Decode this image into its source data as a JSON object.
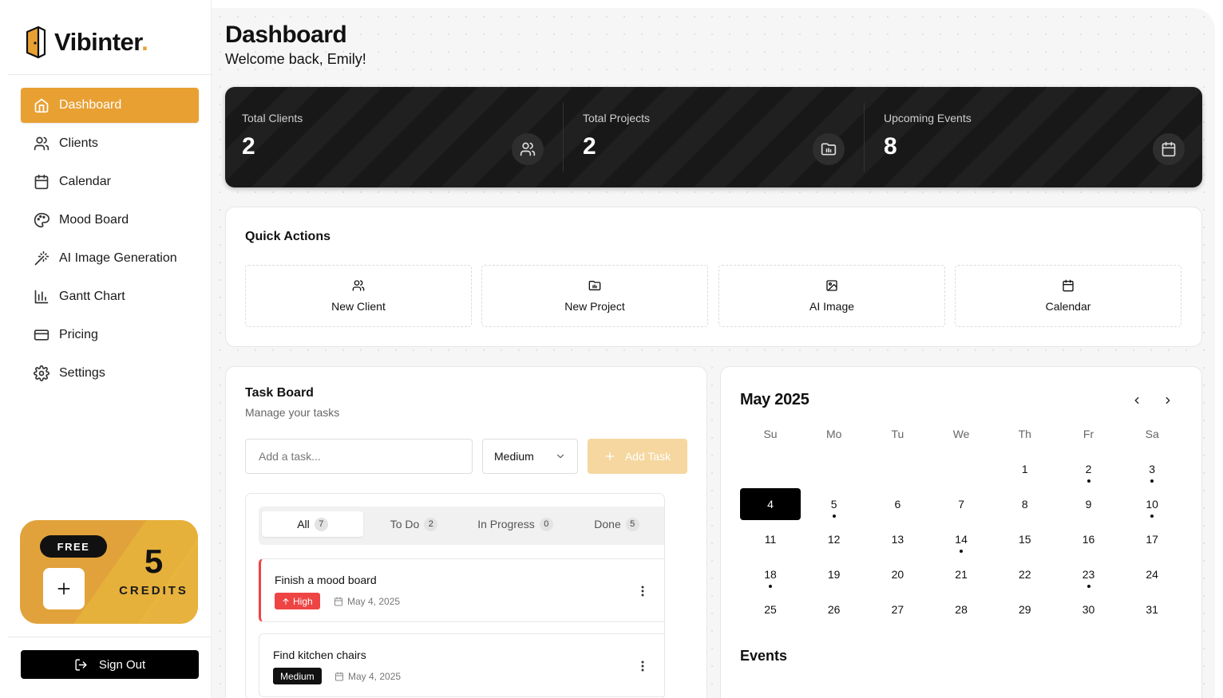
{
  "brand": {
    "name": "Vibinter",
    "dot": ".",
    "accent": "#e8a033"
  },
  "sidebar": {
    "items": [
      {
        "label": "Dashboard",
        "icon": "home-icon",
        "active": true
      },
      {
        "label": "Clients",
        "icon": "users-icon"
      },
      {
        "label": "Calendar",
        "icon": "calendar-icon"
      },
      {
        "label": "Mood Board",
        "icon": "palette-icon"
      },
      {
        "label": "AI Image Generation",
        "icon": "wand-icon"
      },
      {
        "label": "Gantt Chart",
        "icon": "bar-chart-icon"
      },
      {
        "label": "Pricing",
        "icon": "credit-card-icon"
      },
      {
        "label": "Settings",
        "icon": "gear-icon"
      }
    ],
    "plan": {
      "badge": "FREE",
      "credits": "5",
      "credits_label": "CREDITS"
    },
    "sign_out": "Sign Out"
  },
  "header": {
    "title": "Dashboard",
    "subtitle": "Welcome back, Emily!"
  },
  "stats": [
    {
      "label": "Total Clients",
      "value": "2",
      "icon": "users-icon"
    },
    {
      "label": "Total Projects",
      "value": "2",
      "icon": "folder-icon"
    },
    {
      "label": "Upcoming Events",
      "value": "8",
      "icon": "calendar-icon"
    }
  ],
  "quick_actions": {
    "title": "Quick Actions",
    "items": [
      {
        "label": "New Client",
        "icon": "users-icon"
      },
      {
        "label": "New Project",
        "icon": "folder-icon"
      },
      {
        "label": "AI Image",
        "icon": "image-icon"
      },
      {
        "label": "Calendar",
        "icon": "calendar-icon"
      }
    ]
  },
  "task_board": {
    "title": "Task Board",
    "subtitle": "Manage your tasks",
    "input_placeholder": "Add a task...",
    "priority_value": "Medium",
    "add_label": "Add Task",
    "tabs": [
      {
        "label": "All",
        "count": "7",
        "active": true
      },
      {
        "label": "To Do",
        "count": "2"
      },
      {
        "label": "In Progress",
        "count": "0"
      },
      {
        "label": "Done",
        "count": "5"
      }
    ],
    "tasks": [
      {
        "name": "Finish a mood board",
        "priority": "High",
        "date": "May 4, 2025"
      },
      {
        "name": "Find kitchen chairs",
        "priority": "Medium",
        "date": "May 4, 2025"
      }
    ]
  },
  "calendar": {
    "month_label": "May 2025",
    "weekdays": [
      "Su",
      "Mo",
      "Tu",
      "We",
      "Th",
      "Fr",
      "Sa"
    ],
    "first_weekday": 4,
    "days_in_month": 31,
    "selected_day": 4,
    "event_days": [
      2,
      3,
      5,
      10,
      14,
      18,
      23
    ],
    "events_title": "Events"
  }
}
